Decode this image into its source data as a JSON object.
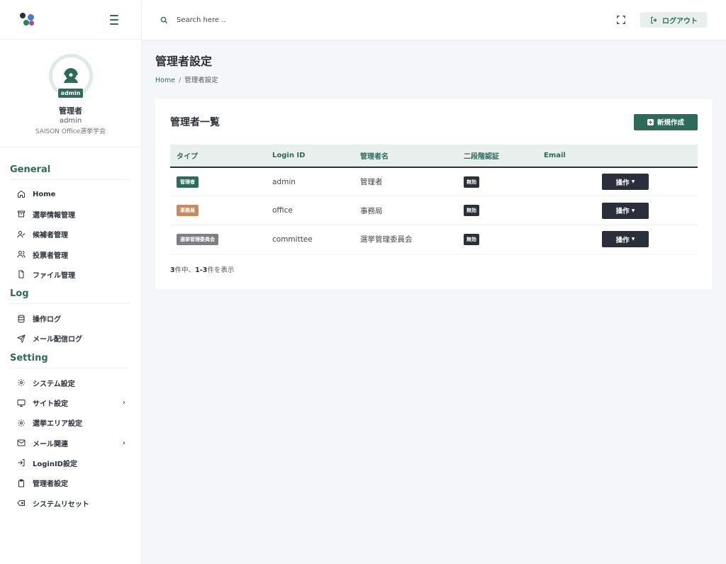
{
  "sidebar": {
    "profile": {
      "badge": "admin",
      "name": "管理者",
      "id": "admin",
      "org": "SAISON Office選挙学会"
    },
    "sections": {
      "general": "General",
      "log": "Log",
      "setting": "Setting"
    },
    "general_items": [
      "Home",
      "選挙情報管理",
      "候補者管理",
      "投票者管理",
      "ファイル管理"
    ],
    "log_items": [
      "操作ログ",
      "メール配信ログ"
    ],
    "setting_items": [
      "システム設定",
      "サイト設定",
      "選挙エリア設定",
      "メール関連",
      "LoginID設定",
      "管理者設定",
      "システムリセット"
    ]
  },
  "header": {
    "search_placeholder": "Search here ..",
    "logout_label": "ログアウト"
  },
  "main": {
    "page_title": "管理者設定",
    "breadcrumb": {
      "home": "Home",
      "current": "管理者設定"
    },
    "card": {
      "title": "管理者一覧",
      "create_label": "新規作成",
      "columns": [
        "タイプ",
        "Login ID",
        "管理者名",
        "二段階認証",
        "Email"
      ],
      "rows": [
        {
          "type": "管理者",
          "login_id": "admin",
          "name": "管理者",
          "twofa": "無効",
          "email": "",
          "action": "操作"
        },
        {
          "type": "事務局",
          "login_id": "office",
          "name": "事務局",
          "twofa": "無効",
          "email": "",
          "action": "操作"
        },
        {
          "type": "選挙管理委員会",
          "login_id": "committee",
          "name": "選挙管理委員会",
          "twofa": "無効",
          "email": "",
          "action": "操作"
        }
      ],
      "summary": {
        "total": "3",
        "total_suffix": "件中、",
        "range": "1-3",
        "range_suffix": "件を表示"
      }
    }
  },
  "colors": {
    "brand": "#2d6a5a",
    "dark": "#2b2f36",
    "office_tag": "#c68b5e",
    "committee_tag": "#7d7f85"
  }
}
